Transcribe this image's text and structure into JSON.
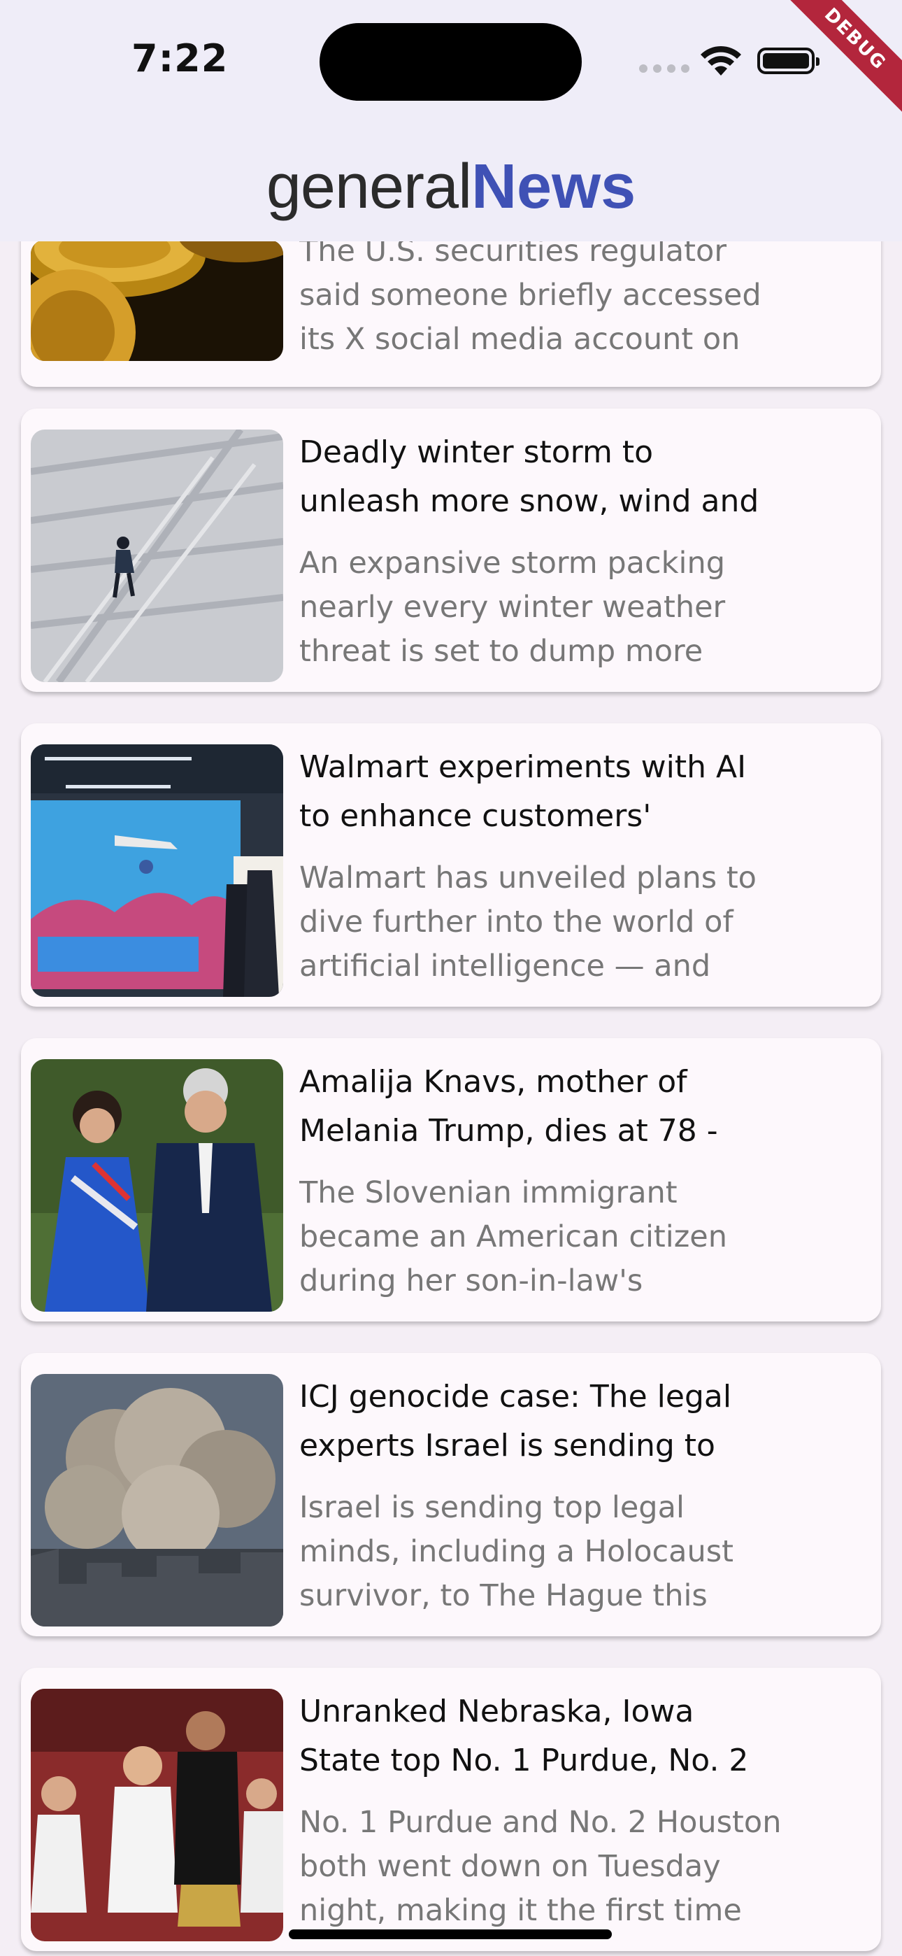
{
  "status_bar": {
    "time": "7:22",
    "debug_label": "DEBUG"
  },
  "app_bar": {
    "title_part1": "general",
    "title_part2": "News"
  },
  "articles": [
    {
      "title": "",
      "desc_lines": [
        "The U.S. securities regulator",
        "said someone briefly accessed",
        "its X social media account on"
      ],
      "image_icon": "bitcoin-coins-image"
    },
    {
      "title_lines": [
        "Deadly winter storm to",
        "unleash more snow, wind and"
      ],
      "desc_lines": [
        "An expansive storm packing",
        "nearly every winter weather",
        "threat is set to dump more"
      ],
      "image_icon": "snow-storm-image"
    },
    {
      "title_lines": [
        "Walmart experiments with AI",
        "to enhance customers'"
      ],
      "desc_lines": [
        "Walmart has unveiled plans to",
        "dive further into the world of",
        "artificial intelligence — and"
      ],
      "image_icon": "drone-presentation-image"
    },
    {
      "title_lines": [
        "Amalija Knavs, mother of",
        "Melania Trump, dies at 78 -"
      ],
      "desc_lines": [
        "The Slovenian immigrant",
        "became an American citizen",
        "during her son-in-law's"
      ],
      "image_icon": "melania-trump-photo"
    },
    {
      "title_lines": [
        "ICJ genocide case: The legal",
        "experts Israel is sending to"
      ],
      "desc_lines": [
        "Israel is sending top legal",
        "minds, including a Holocaust",
        "survivor, to The Hague this"
      ],
      "image_icon": "smoke-city-image"
    },
    {
      "title_lines": [
        "Unranked Nebraska, Iowa",
        "State top No. 1 Purdue, No. 2"
      ],
      "desc_lines": [
        "No. 1 Purdue and No. 2 Houston",
        "both went down on Tuesday",
        "night, making it the first time"
      ],
      "image_icon": "basketball-game-image"
    }
  ],
  "colors": {
    "brand": "#3f51b5",
    "card_bg": "#fdf8fc",
    "app_bar_bg": "#efedf8"
  }
}
